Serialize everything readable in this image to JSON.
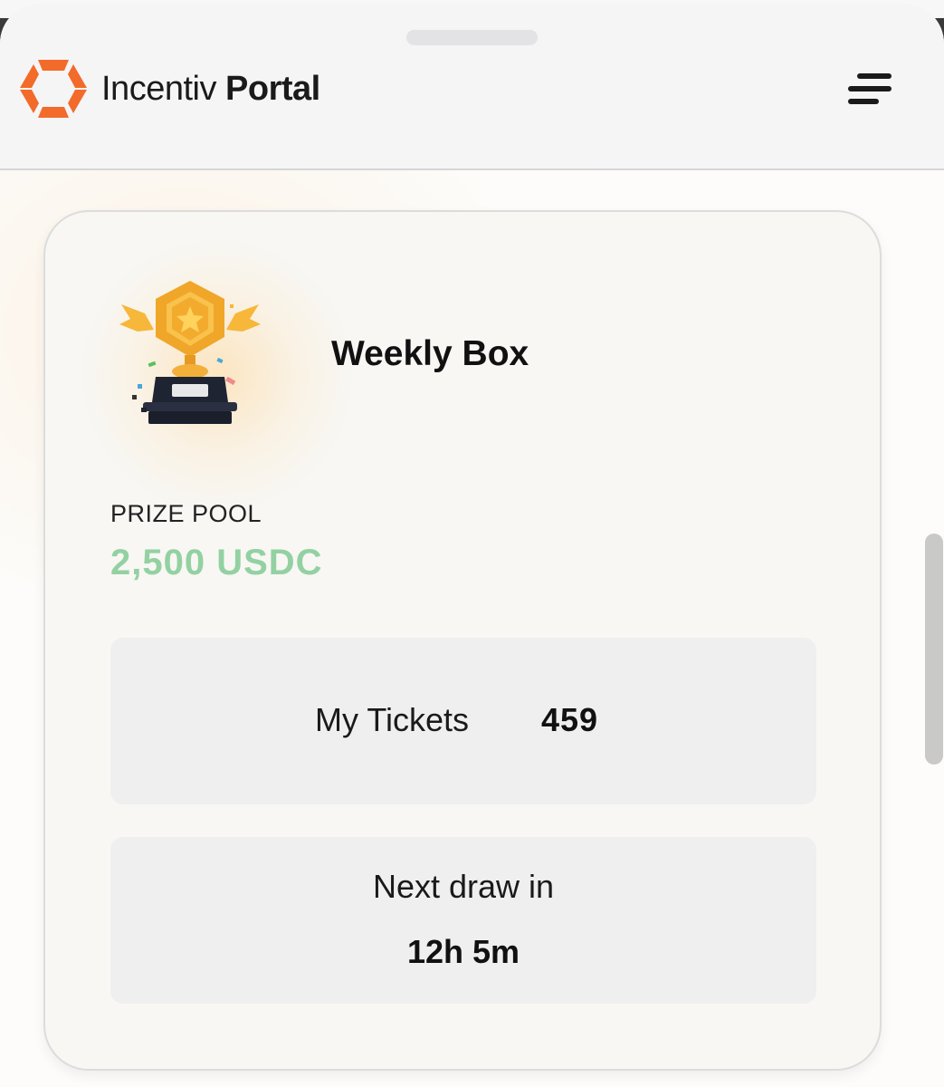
{
  "header": {
    "brand_part1": "Incentiv",
    "brand_part2": "Portal",
    "logo_icon": "incentiv-logo-icon",
    "menu_icon": "hamburger-menu-icon",
    "accent_color": "#f26b2a"
  },
  "card": {
    "title": "Weekly Box",
    "image_icon": "trophy-icon",
    "prize_pool_label": "PRIZE POOL",
    "prize_pool_value": "2,500 USDC",
    "prize_pool_color": "#93d1a2",
    "tickets_label": "My Tickets",
    "tickets_value": "459",
    "next_draw_label": "Next draw in",
    "next_draw_value": "12h 5m"
  }
}
